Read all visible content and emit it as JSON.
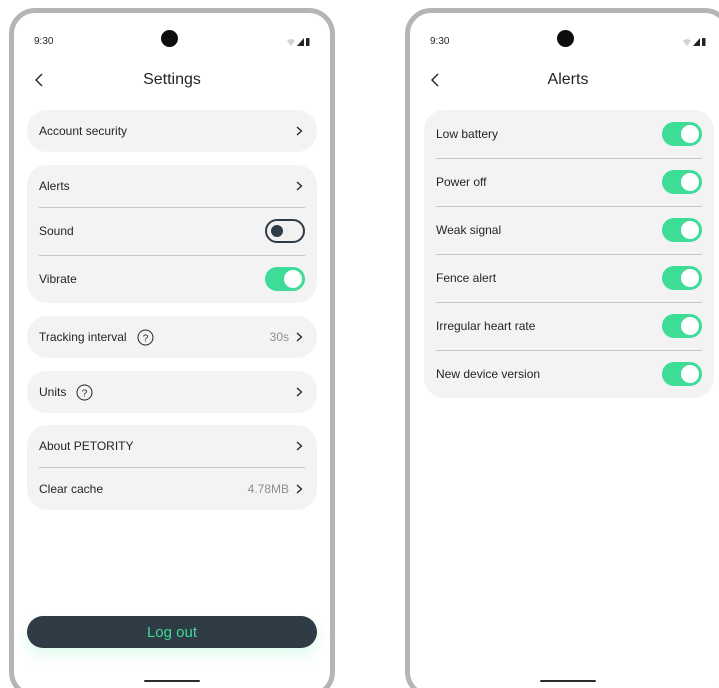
{
  "colors": {
    "accent": "#3ddc97",
    "dark": "#2f3b45",
    "card": "#f3f3f3"
  },
  "settings_screen": {
    "status_time": "9:30",
    "title": "Settings",
    "account_security": {
      "label": "Account security"
    },
    "alerts": {
      "label": "Alerts"
    },
    "sound": {
      "label": "Sound",
      "on": false
    },
    "vibrate": {
      "label": "Vibrate",
      "on": true
    },
    "tracking_interval": {
      "label": "Tracking interval",
      "value": "30s",
      "icon": "help-circle-icon"
    },
    "units": {
      "label": "Units",
      "icon": "help-circle-icon"
    },
    "about": {
      "label": "About PETORITY"
    },
    "clear_cache": {
      "label": "Clear cache",
      "value": "4.78MB"
    },
    "logout_label": "Log out"
  },
  "alerts_screen": {
    "status_time": "9:30",
    "title": "Alerts",
    "items": [
      {
        "label": "Low battery",
        "on": true
      },
      {
        "label": "Power off",
        "on": true
      },
      {
        "label": "Weak signal",
        "on": true
      },
      {
        "label": "Fence alert",
        "on": true
      },
      {
        "label": "Irregular heart rate",
        "on": true
      },
      {
        "label": "New device version",
        "on": true
      }
    ]
  }
}
